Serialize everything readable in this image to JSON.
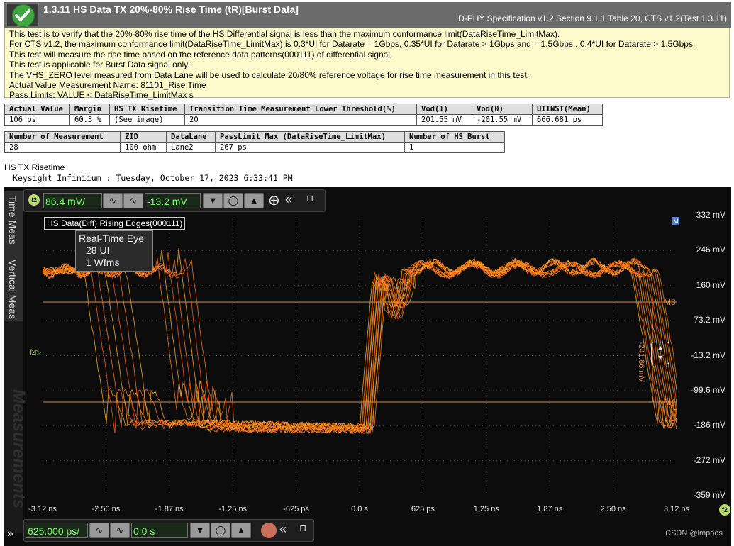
{
  "header": {
    "title": "1.3.11 HS Data TX 20%-80% Rise Time (tR)[Burst Data]",
    "spec": "D-PHY Specification v1.2 Section 9.1.1 Table 20, CTS v1.2(Test 1.3.11)"
  },
  "description": [
    "This test is to verify that the 20%-80% rise time of the HS Differential signal is less than the maximum conformance limit(DataRiseTime_LimitMax).",
    "For CTS v1.2, the maximum conformance limit(DataRiseTime_LimitMax) is 0.3*UI for Datarate = 1Gbps, 0.35*UI for Datarate > 1Gbps and = 1.5Gbps , 0.4*UI for Datarate > 1.5Gbps.",
    "This test will measure the rise time based on the reference data patterns(000111) of differential signal.",
    "This test is applicable for Burst Data signal only.",
    "The VHS_ZERO level measured from Data Lane will be used to calculate 20/80% reference voltage for rise time measurement in this test.",
    "Actual Value Measurement Name: 81101_Rise Time",
    "Pass Limits: VALUE < DataRiseTime_LimitMax s"
  ],
  "table1": {
    "headers": [
      "Actual Value",
      "Margin",
      "HS TX Risetime",
      "Transition Time Measurement Lower Threshold(%)",
      "Vod(1)",
      "Vod(0)",
      "UIINST(Mean)"
    ],
    "row": [
      "106 ps",
      "60.3 %",
      "(See image)",
      "20",
      "201.55 mV",
      "-201.55 mV",
      "666.681 ps"
    ]
  },
  "table2": {
    "headers": [
      "Number of Measurement",
      "ZID",
      "DataLane",
      "PassLimit Max (DataRiseTime_LimitMax)",
      "Number of HS Burst"
    ],
    "row": [
      "28",
      "100 ohm",
      "Lane2",
      "267 ps",
      "1"
    ]
  },
  "section_title": "HS TX Risetime",
  "scope_caption": "Keysight Infiniium : Tuesday, October 17, 2023 6:33:41 PM",
  "scope": {
    "tabs": [
      "Time Meas",
      "Vertical Meas"
    ],
    "watermark_tab": "Measurements",
    "channel": "f2",
    "v_scale": "86.4 mV/",
    "v_offset": "-13.2 mV",
    "h_scale": "625.000 ps/",
    "h_delay": "0.0 s",
    "overlay_label": "HS Data(Diff) Rising Edges(000111)",
    "eye_title": "Real-Time Eye",
    "eye_ui": "28 UI",
    "eye_wfms": "1 Wfms",
    "y_ticks": [
      "332 mV",
      "246 mV",
      "160 mV",
      "73.2 mV",
      "-13.2 mV",
      "-99.6 mV",
      "-186 mV",
      "-272 mV",
      "-359 mV"
    ],
    "x_ticks": [
      "-3.12 ns",
      "-2.50 ns",
      "-1.87 ns",
      "-1.25 ns",
      "-625 ps",
      "0.0 s",
      "625 ps",
      "1.25 ns",
      "1.87 ns",
      "2.50 ns",
      "3.12 ns"
    ],
    "marker_m3": "M3",
    "marker_m4": "M4",
    "marker_delta": "-241.86 mV",
    "trace_color": "#ff7a1a",
    "marker_color": "#e08a3c"
  },
  "watermark": "CSDN @lmpoos"
}
